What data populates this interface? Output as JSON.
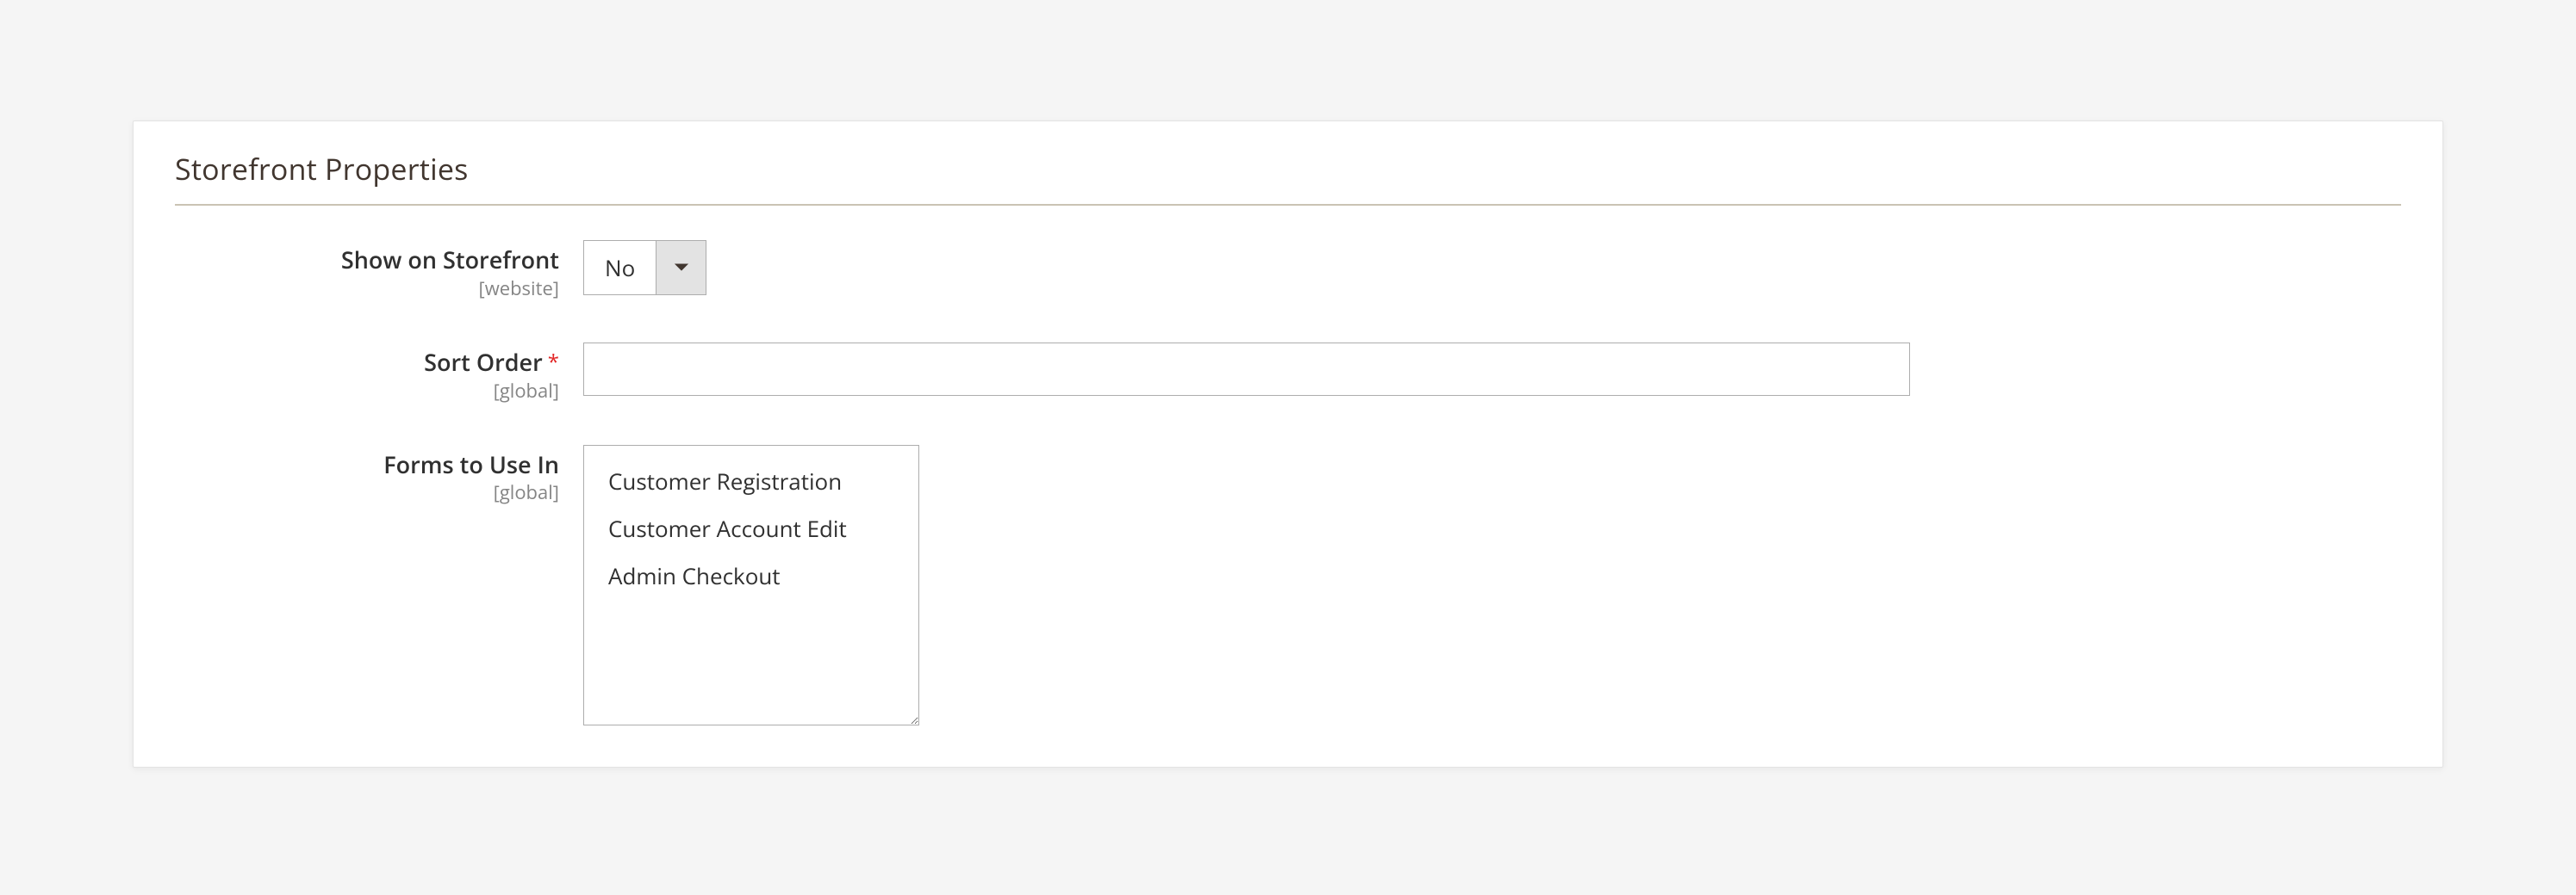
{
  "panel": {
    "title": "Storefront Properties"
  },
  "fields": {
    "show_on_storefront": {
      "label": "Show on Storefront",
      "scope": "[website]",
      "value": "No"
    },
    "sort_order": {
      "label": "Sort Order",
      "scope": "[global]",
      "required_mark": "*",
      "value": ""
    },
    "forms_to_use_in": {
      "label": "Forms to Use In",
      "scope": "[global]",
      "options": [
        "Customer Registration",
        "Customer Account Edit",
        "Admin Checkout"
      ]
    }
  }
}
